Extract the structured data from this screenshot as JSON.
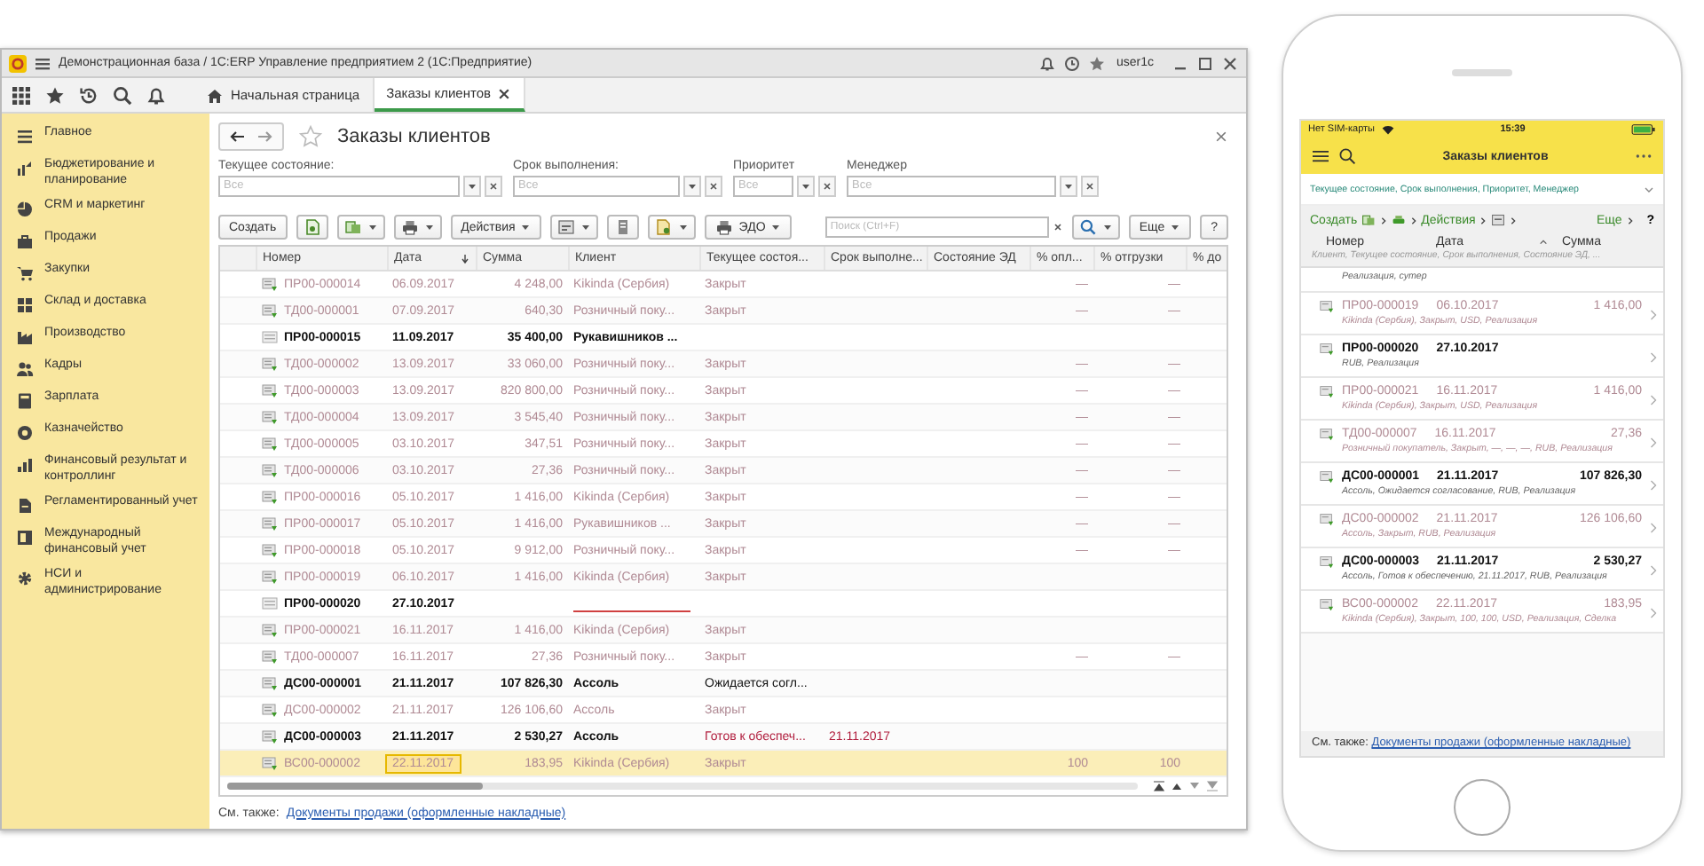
{
  "window": {
    "title": "Демонстрационная база / 1С:ERP Управление предприятием 2 (1С:Предприятие)",
    "user": "user1c"
  },
  "tabs": [
    {
      "label": "Начальная страница",
      "selected": false,
      "closable": false
    },
    {
      "label": "Заказы клиентов",
      "selected": true,
      "closable": true
    }
  ],
  "sidebar": {
    "items": [
      {
        "label": "Главное"
      },
      {
        "label": "Бюджетирование и планирование"
      },
      {
        "label": "CRM и маркетинг"
      },
      {
        "label": "Продажи"
      },
      {
        "label": "Закупки"
      },
      {
        "label": "Склад и доставка"
      },
      {
        "label": "Производство"
      },
      {
        "label": "Кадры"
      },
      {
        "label": "Зарплата"
      },
      {
        "label": "Казначейство"
      },
      {
        "label": "Финансовый результат и контроллинг"
      },
      {
        "label": "Регламентированный учет"
      },
      {
        "label": "Международный финансовый учет"
      },
      {
        "label": "НСИ и администрирование"
      }
    ]
  },
  "page": {
    "title": "Заказы клиентов"
  },
  "filters": [
    {
      "label": "Текущее состояние:",
      "placeholder": "Все"
    },
    {
      "label": "Срок выполнения:",
      "placeholder": "Все"
    },
    {
      "label": "Приоритет",
      "placeholder": "Все"
    },
    {
      "label": "Менеджер",
      "placeholder": "Все"
    }
  ],
  "toolbar": {
    "create": "Создать",
    "actions": "Действия",
    "edo": "ЭДО",
    "search_placeholder": "Поиск (Ctrl+F)",
    "more": "Еще",
    "help": "?"
  },
  "table": {
    "columns": [
      {
        "label": "Номер",
        "sorted": false
      },
      {
        "label": "Дата",
        "sorted": true
      },
      {
        "label": "Сумма",
        "sorted": false
      },
      {
        "label": "Клиент",
        "sorted": false
      },
      {
        "label": "Текущее состоя...",
        "sorted": false
      },
      {
        "label": "Срок выполне...",
        "sorted": false
      },
      {
        "label": "Состояние ЭД",
        "sorted": false
      },
      {
        "label": "% опл...",
        "sorted": false
      },
      {
        "label": "% отгрузки",
        "sorted": false
      },
      {
        "label": "% до",
        "sorted": false
      }
    ],
    "rows": [
      {
        "number": "ПР00-000014",
        "date": "06.09.2017",
        "sum": "4 248,00",
        "client": "Kikinda (Сербия)",
        "state": {
          "text": "Закрыт",
          "attention": false
        },
        "pct_paid": "—",
        "pct_shipped": "—",
        "closed": true,
        "posted": true,
        "client_missing": false,
        "selected": false
      },
      {
        "number": "ТД00-000001",
        "date": "07.09.2017",
        "sum": "640,30",
        "client": "Розничный поку...",
        "state": {
          "text": "Закрыт",
          "attention": false
        },
        "pct_paid": "—",
        "pct_shipped": "—",
        "closed": true,
        "posted": true,
        "client_missing": false,
        "selected": false
      },
      {
        "number": "ПР00-000015",
        "date": "11.09.2017",
        "sum": "35 400,00",
        "client": "Рукавишников ...",
        "closed": false,
        "posted": false,
        "client_missing": false,
        "selected": false
      },
      {
        "number": "ТД00-000002",
        "date": "13.09.2017",
        "sum": "33 060,00",
        "client": "Розничный поку...",
        "state": {
          "text": "Закрыт",
          "attention": false
        },
        "pct_paid": "—",
        "pct_shipped": "—",
        "closed": true,
        "posted": true,
        "client_missing": false,
        "selected": false
      },
      {
        "number": "ТД00-000003",
        "date": "13.09.2017",
        "sum": "820 800,00",
        "client": "Розничный поку...",
        "state": {
          "text": "Закрыт",
          "attention": false
        },
        "pct_paid": "—",
        "pct_shipped": "—",
        "closed": true,
        "posted": true,
        "client_missing": false,
        "selected": false
      },
      {
        "number": "ТД00-000004",
        "date": "13.09.2017",
        "sum": "3 545,40",
        "client": "Розничный поку...",
        "state": {
          "text": "Закрыт",
          "attention": false
        },
        "pct_paid": "—",
        "pct_shipped": "—",
        "closed": true,
        "posted": true,
        "client_missing": false,
        "selected": false
      },
      {
        "number": "ТД00-000005",
        "date": "03.10.2017",
        "sum": "347,51",
        "client": "Розничный поку...",
        "state": {
          "text": "Закрыт",
          "attention": false
        },
        "pct_paid": "—",
        "pct_shipped": "—",
        "closed": true,
        "posted": true,
        "client_missing": false,
        "selected": false
      },
      {
        "number": "ТД00-000006",
        "date": "03.10.2017",
        "sum": "27,36",
        "client": "Розничный поку...",
        "state": {
          "text": "Закрыт",
          "attention": false
        },
        "pct_paid": "—",
        "pct_shipped": "—",
        "closed": true,
        "posted": true,
        "client_missing": false,
        "selected": false
      },
      {
        "number": "ПР00-000016",
        "date": "05.10.2017",
        "sum": "1 416,00",
        "client": "Kikinda (Сербия)",
        "state": {
          "text": "Закрыт",
          "attention": false
        },
        "pct_paid": "—",
        "pct_shipped": "—",
        "closed": true,
        "posted": true,
        "client_missing": false,
        "selected": false
      },
      {
        "number": "ПР00-000017",
        "date": "05.10.2017",
        "sum": "1 416,00",
        "client": "Рукавишников ...",
        "state": {
          "text": "Закрыт",
          "attention": false
        },
        "pct_paid": "—",
        "pct_shipped": "—",
        "closed": true,
        "posted": true,
        "client_missing": false,
        "selected": false
      },
      {
        "number": "ПР00-000018",
        "date": "05.10.2017",
        "sum": "9 912,00",
        "client": "Розничный поку...",
        "state": {
          "text": "Закрыт",
          "attention": false
        },
        "pct_paid": "—",
        "pct_shipped": "—",
        "closed": true,
        "posted": true,
        "client_missing": false,
        "selected": false
      },
      {
        "number": "ПР00-000019",
        "date": "06.10.2017",
        "sum": "1 416,00",
        "client": "Kikinda (Сербия)",
        "state": {
          "text": "Закрыт",
          "attention": false
        },
        "closed": true,
        "posted": true,
        "client_missing": false,
        "selected": false
      },
      {
        "number": "ПР00-000020",
        "date": "27.10.2017",
        "closed": false,
        "posted": false,
        "client_missing": true,
        "selected": false
      },
      {
        "number": "ПР00-000021",
        "date": "16.11.2017",
        "sum": "1 416,00",
        "client": "Kikinda (Сербия)",
        "state": {
          "text": "Закрыт",
          "attention": false
        },
        "closed": true,
        "posted": true,
        "client_missing": false,
        "selected": false
      },
      {
        "number": "ТД00-000007",
        "date": "16.11.2017",
        "sum": "27,36",
        "client": "Розничный поку...",
        "state": {
          "text": "Закрыт",
          "attention": false
        },
        "pct_paid": "—",
        "pct_shipped": "—",
        "closed": true,
        "posted": true,
        "client_missing": false,
        "selected": false
      },
      {
        "number": "ДС00-000001",
        "date": "21.11.2017",
        "sum": "107 826,30",
        "client": "Ассоль",
        "state": {
          "text": "Ожидается согл...",
          "attention": false
        },
        "closed": false,
        "posted": true,
        "client_missing": false,
        "selected": false
      },
      {
        "number": "ДС00-000002",
        "date": "21.11.2017",
        "sum": "126 106,60",
        "client": "Ассоль",
        "state": {
          "text": "Закрыт",
          "attention": false
        },
        "closed": true,
        "posted": true,
        "client_missing": false,
        "selected": false
      },
      {
        "number": "ДС00-000003",
        "date": "21.11.2017",
        "sum": "2 530,27",
        "client": "Ассоль",
        "state": {
          "text": "Готов к обеспеч...",
          "attention": true
        },
        "deadline": "21.11.2017",
        "closed": false,
        "posted": true,
        "client_missing": false,
        "selected": false
      },
      {
        "number": "ВС00-000002",
        "date": "22.11.2017",
        "sum": "183,95",
        "client": "Kikinda (Сербия)",
        "state": {
          "text": "Закрыт",
          "attention": false
        },
        "pct_paid": "100",
        "pct_shipped": "100",
        "closed": true,
        "posted": true,
        "client_missing": false,
        "selected": true
      }
    ]
  },
  "footer": {
    "label": "См. также:",
    "link": "Документы продажи (оформленные накладные)"
  },
  "phone": {
    "carrier": "Нет SIM-карты",
    "time": "15:39",
    "title": "Заказы клиентов",
    "filter": "Текущее состояние, Срок выполнения, Приоритет, Менеджер",
    "create": "Создать",
    "actions": "Действия",
    "more": "Еще",
    "help": "?",
    "columns": [
      "Номер",
      "Дата",
      "Сумма"
    ],
    "subcolumns": "Клиент, Текущее состояние, Срок выполнения, Состояние ЭД, ...",
    "partial": "Реализация, сутер",
    "items": [
      {
        "number": "ПР00-000019",
        "date": "06.10.2017",
        "sum": "1 416,00",
        "details": "Kikinda (Сербия), Закрыт, USD, Реализация",
        "closed": true
      },
      {
        "number": "ПР00-000020",
        "date": "27.10.2017",
        "details": "RUB, Реализация",
        "closed": false
      },
      {
        "number": "ПР00-000021",
        "date": "16.11.2017",
        "sum": "1 416,00",
        "details": "Kikinda (Сербия), Закрыт, USD, Реализация",
        "closed": true
      },
      {
        "number": "ТД00-000007",
        "date": "16.11.2017",
        "sum": "27,36",
        "details": "Розничный покупатель, Закрыт, —, —, —, RUB, Реализация",
        "closed": true
      },
      {
        "number": "ДС00-000001",
        "date": "21.11.2017",
        "sum": "107 826,30",
        "details": "Ассоль, Ожидается согласование, RUB, Реализация",
        "closed": false
      },
      {
        "number": "ДС00-000002",
        "date": "21.11.2017",
        "sum": "126 106,60",
        "details": "Ассоль, Закрыт, RUB, Реализация",
        "closed": true
      },
      {
        "number": "ДС00-000003",
        "date": "21.11.2017",
        "sum": "2 530,27",
        "details": "Ассоль, Готов к обеспечению, 21.11.2017, RUB, Реализация",
        "closed": false
      },
      {
        "number": "ВС00-000002",
        "date": "22.11.2017",
        "sum": "183,95",
        "details": "Kikinda (Сербия), Закрыт, 100, 100, USD, Реализация, Сделка",
        "closed": true
      }
    ],
    "footer_label": "См. также:",
    "footer_link": "Документы продажи (оформленные накладные)"
  }
}
